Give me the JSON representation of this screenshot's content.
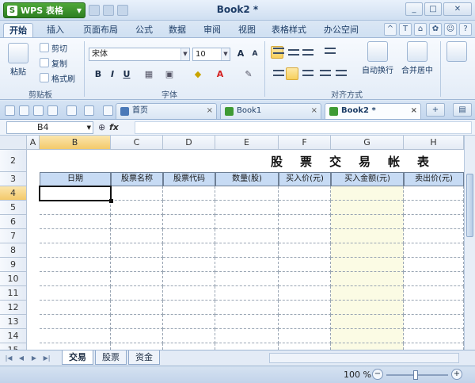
{
  "app": {
    "menu_label": "WPS 表格",
    "doc_title": "Book2 *"
  },
  "ribbon_tabs": [
    "开始",
    "插入",
    "页面布局",
    "公式",
    "数据",
    "审阅",
    "视图",
    "表格样式",
    "办公空间"
  ],
  "clipboard": {
    "paste": "粘贴",
    "cut": "剪切",
    "copy": "复制",
    "format_painter": "格式刷",
    "group": "剪贴板"
  },
  "font": {
    "name": "宋体",
    "size": "10",
    "group": "字体",
    "bold": "B",
    "italic": "I",
    "underline": "U"
  },
  "alignment": {
    "group": "对齐方式",
    "wrap": "自动换行",
    "merge": "合并居中"
  },
  "doc_tabs": [
    {
      "label": "首页",
      "close": "×"
    },
    {
      "label": "Book1",
      "close": "×"
    },
    {
      "label": "Book2 *",
      "close": "×"
    }
  ],
  "formula_bar": {
    "cell_ref": "B4",
    "fx": "fx",
    "value": ""
  },
  "grid": {
    "columns": [
      "A",
      "B",
      "C",
      "D",
      "E",
      "F",
      "G",
      "H"
    ],
    "rows": [
      "2",
      "3",
      "4",
      "5",
      "6",
      "7",
      "8",
      "9",
      "10",
      "11",
      "12",
      "13",
      "14",
      "15"
    ],
    "title": "股票交易帐表",
    "headers": [
      "日期",
      "股票名称",
      "股票代码",
      "数量(股)",
      "买入价(元)",
      "买入金额(元)",
      "卖出价(元)"
    ]
  },
  "sheets": [
    "交易",
    "股票",
    "资金"
  ],
  "status": {
    "zoom": "100 %"
  },
  "colors": {
    "accent": "#2d7f21",
    "header_fill": "#c7dbf4",
    "highlight_col": "#fbfbe4"
  }
}
